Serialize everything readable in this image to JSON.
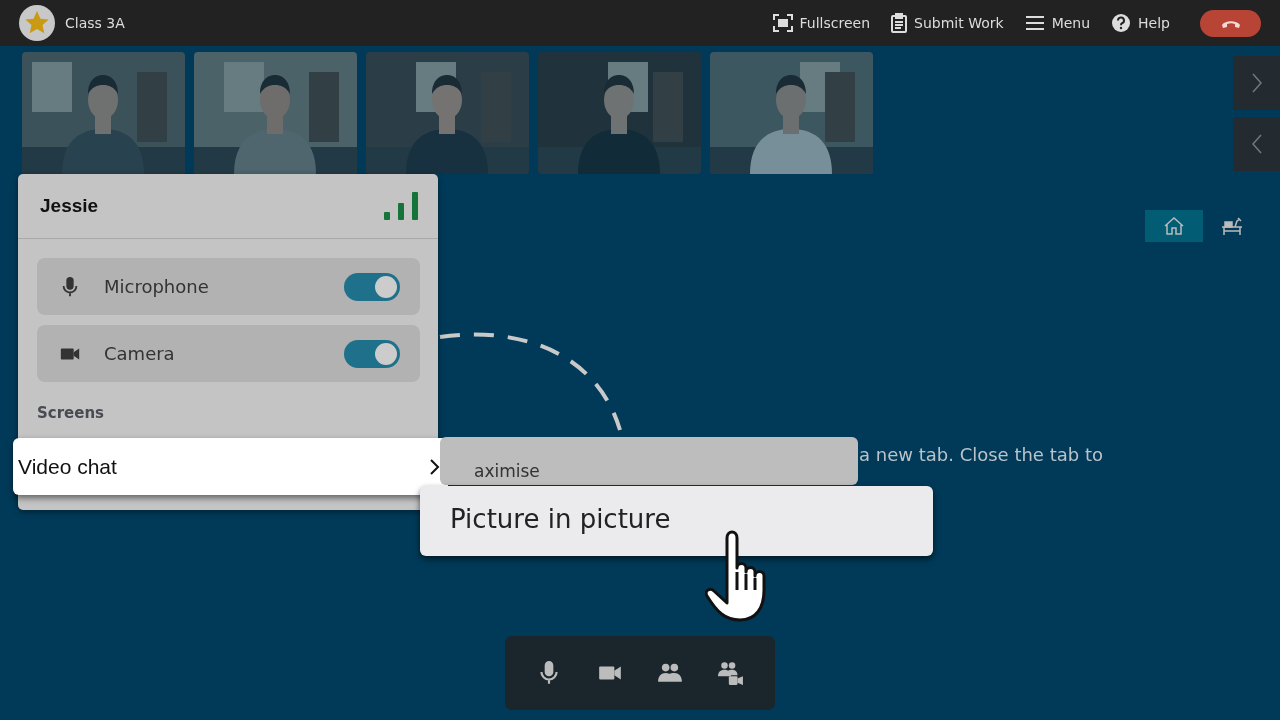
{
  "header": {
    "class_name": "Class 3A",
    "actions": [
      {
        "label": "Fullscreen",
        "kind": "fullscreen"
      },
      {
        "label": "Submit Work",
        "kind": "submit"
      },
      {
        "label": "Menu",
        "kind": "menu"
      },
      {
        "label": "Help",
        "kind": "help"
      }
    ]
  },
  "view_tabs": [
    {
      "kind": "home",
      "selected": true
    },
    {
      "kind": "desk",
      "selected": false
    }
  ],
  "body_text": "a new tab. Close the tab to",
  "participant_panel": {
    "name": "Jessie",
    "controls": [
      {
        "label": "Microphone",
        "kind": "microphone",
        "on": true
      },
      {
        "label": "Camera",
        "kind": "camera",
        "on": true
      }
    ],
    "section": "Screens",
    "menu_item": "Video chat"
  },
  "submenu": [
    {
      "label": "aximise",
      "highlighted": false
    },
    {
      "label": "Picture in picture",
      "highlighted": true
    }
  ],
  "toolbar": [
    {
      "kind": "microphone"
    },
    {
      "kind": "camera"
    },
    {
      "kind": "people"
    },
    {
      "kind": "people-video"
    }
  ]
}
